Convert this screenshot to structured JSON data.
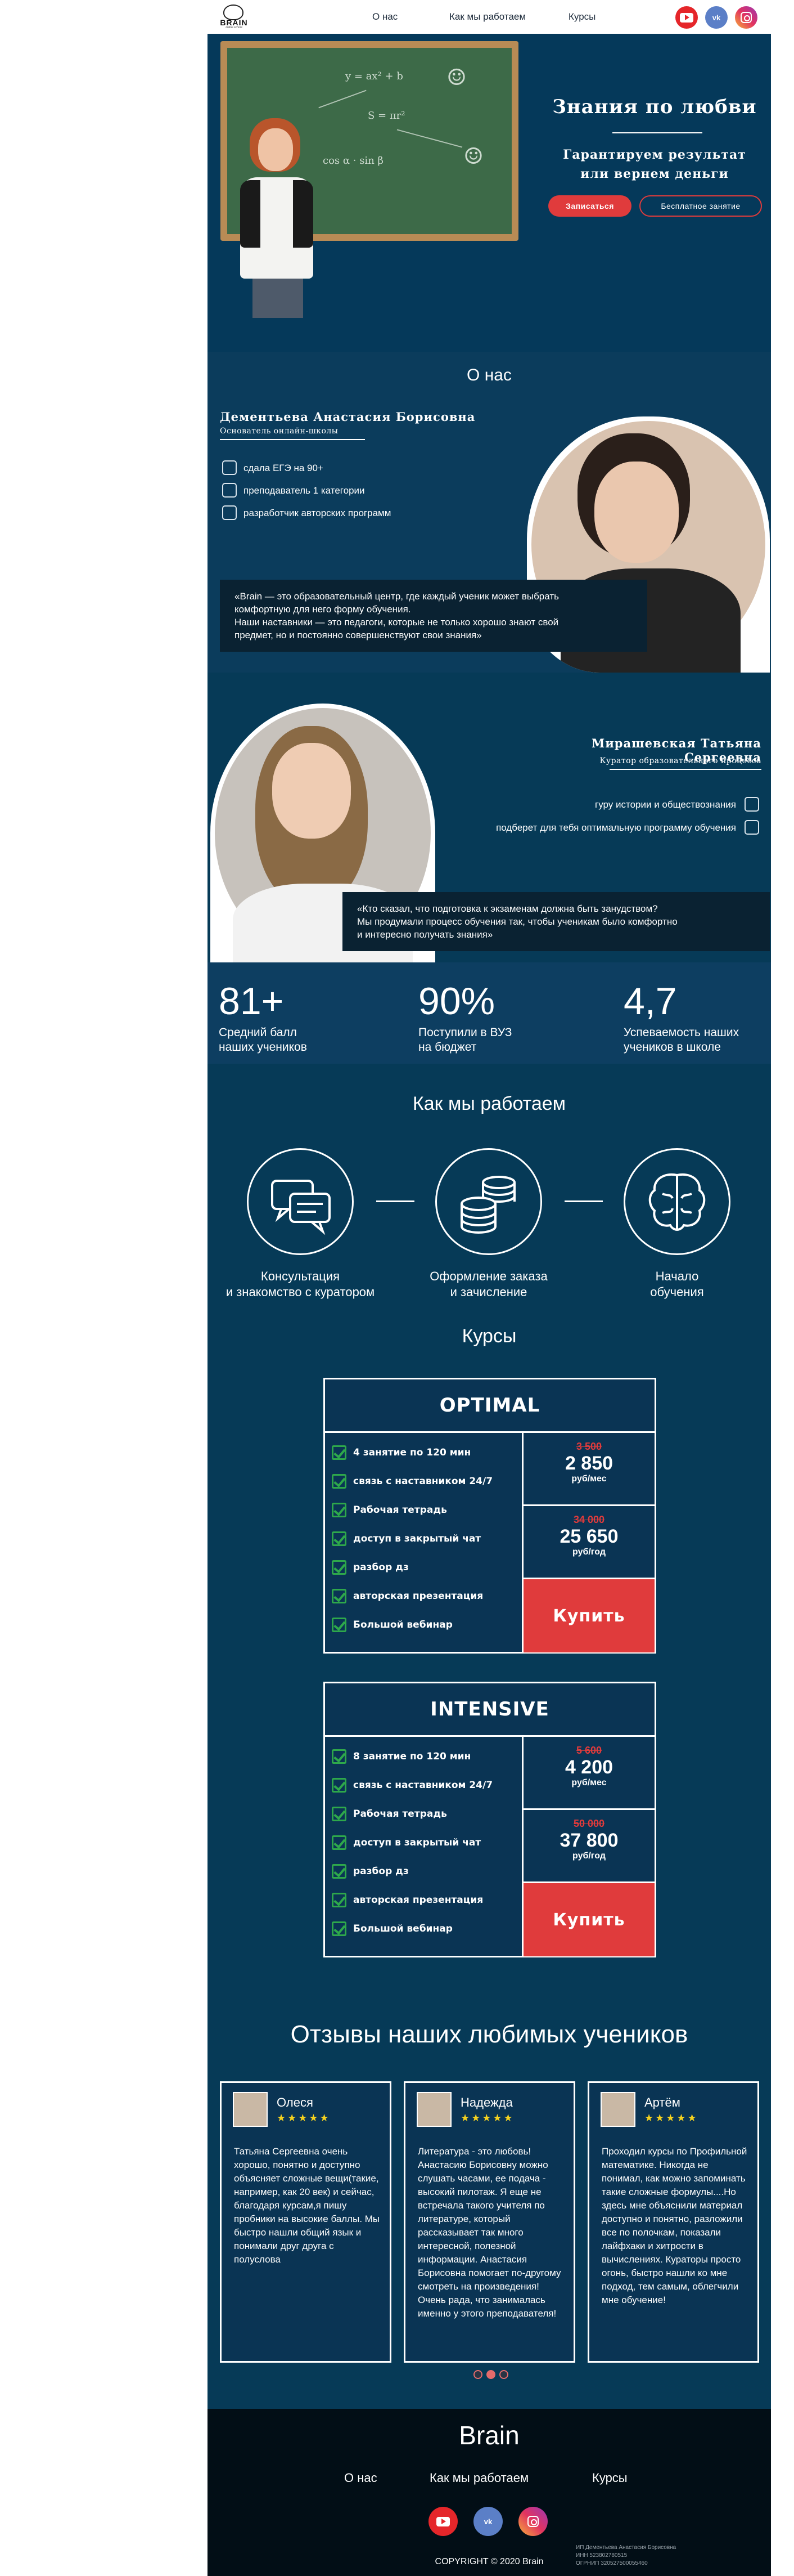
{
  "header": {
    "logo_text": "BRAIN",
    "logo_sub": "online school",
    "nav": [
      "О нас",
      "Как мы работаем",
      "Курсы"
    ],
    "social": [
      "youtube-icon",
      "vk-icon",
      "instagram-icon"
    ],
    "vk_label": "vk"
  },
  "hero": {
    "title": "Знания по любви",
    "subtitle_1": "Гарантируем результат",
    "subtitle_2": "или вернем деньги",
    "cta_primary": "Записаться",
    "cta_secondary": "Бесплатное занятие"
  },
  "about": {
    "title": "О нас",
    "person1": {
      "name": "Дементьева Анастасия Борисовна",
      "role": "Основатель онлайн-школы",
      "features": [
        "сдала ЕГЭ на 90+",
        "преподаватель 1 категории",
        "разработчик авторских программ"
      ],
      "quote_1": "«Brain — это образовательный центр, где каждый ученик может выбрать",
      "quote_2": "комфортную для него форму обучения.",
      "quote_3": "Наши наставники — это педагоги, которые не только хорошо знают свой",
      "quote_4": "предмет, но и постоянно совершенствуют свои знания»"
    },
    "person2": {
      "name": "Мирашевская Татьяна Сергеевна",
      "role": "Куратор образовательного процесса",
      "features": [
        "гуру истории и обществознания",
        "подберет для тебя оптимальную программу обучения"
      ],
      "quote_1": "«Кто сказал, что подготовка к экзаменам должна быть занудством?",
      "quote_2": "Мы продумали процесс обучения так, чтобы ученикам было комфортно",
      "quote_3": "и интересно получать знания»"
    }
  },
  "stats": [
    {
      "number": "81+",
      "line1": "Средний балл",
      "line2": "наших учеников"
    },
    {
      "number": "90%",
      "line1": "Поступили в ВУЗ",
      "line2": "на бюджет"
    },
    {
      "number": "4,7",
      "line1": "Успеваемость наших",
      "line2": "учеников в школе"
    }
  ],
  "how": {
    "title": "Как мы работаем",
    "steps": [
      {
        "icon": "chat-bubbles-icon",
        "line1": "Консультация",
        "line2": "и знакомство с куратором"
      },
      {
        "icon": "coins-stack-icon",
        "line1": "Оформление заказа",
        "line2": "и зачисление"
      },
      {
        "icon": "brain-icon",
        "line1": "Начало",
        "line2": "обучения"
      }
    ]
  },
  "courses": {
    "title": "Курсы",
    "plans": [
      {
        "name": "OPTIMAL",
        "features": [
          "4 занятие по 120 мин",
          "связь с наставником 24/7",
          "Рабочая тетрадь",
          "доступ в закрытый чат",
          "разбор дз",
          "авторская презентация",
          "Большой вебинар"
        ],
        "month_old": "3 500",
        "month_new": "2 850",
        "month_unit": "руб/мес",
        "year_old": "34 000",
        "year_new": "25 650",
        "year_unit": "руб/год",
        "buy": "Купить"
      },
      {
        "name": "INTENSIVE",
        "features": [
          "8 занятие по 120 мин",
          "связь с наставником 24/7",
          "Рабочая тетрадь",
          "доступ в закрытый чат",
          "разбор дз",
          "авторская презентация",
          "Большой вебинар"
        ],
        "month_old": "5 600",
        "month_new": "4 200",
        "month_unit": "руб/мес",
        "year_old": "50 000",
        "year_new": "37 800",
        "year_unit": "руб/год",
        "buy": "Купить"
      }
    ]
  },
  "reviews": {
    "title": "Отзывы наших любимых учеников",
    "items": [
      {
        "name": "Олеся",
        "stars": "★★★★★",
        "text": "Татьяна Сергеевна очень хорошо, понятно и доступно объясняет сложные вещи(такие, например, как 20 век) и сейчас, благодаря курсам,я пишу пробники на высокие баллы. Мы быстро нашли общий язык и понимали друг друга с полуслова"
      },
      {
        "name": "Надежда",
        "stars": "★★★★★",
        "text": "Литература - это любовь! Анастасию Борисовну можно слушать часами, ее подача - высокий пилотаж. Я еще не встречала такого учителя по литературе, который рассказывает так много интересной, полезной информации. Анастасия Борисовна помогает по-другому смотреть на произведения! Очень рада, что занималась именно у этого преподавателя!"
      },
      {
        "name": "Артём",
        "stars": "★★★★★",
        "text": "Проходил курсы по Профильной математике. Никогда не понимал, как можно запоминать такие сложные формулы....Но здесь мне объяснили материал доступно и понятно, разложили все по полочкам, показали лайфхаки и хитрости в вычислениях. Кураторы просто огонь, быстро нашли ко мне подход, тем самым, облегчили мне обучение!"
      }
    ]
  },
  "footer": {
    "brand": "Brain",
    "nav": [
      "О нас",
      "Как мы работаем",
      "Курсы"
    ],
    "copyright": "COPYRIGHT © 2020 Brain",
    "legal_1": "ИП Дементьева Анастасия Борисовна",
    "legal_2": "ИНН 523802780515",
    "legal_3": "ОГРНИП 320527500055460"
  },
  "colors": {
    "bg_dark": "#063a57",
    "accent_red": "#e03b3c",
    "check_green": "#2ea84b",
    "star_yellow": "#f5d21f",
    "footer": "#020e16"
  }
}
